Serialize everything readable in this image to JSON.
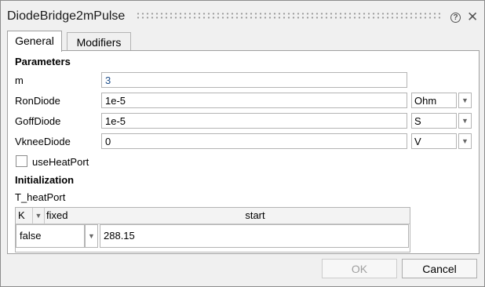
{
  "dialog": {
    "title": "DiodeBridge2mPulse"
  },
  "tabs": [
    {
      "label": "General"
    },
    {
      "label": "Modifiers"
    }
  ],
  "parameters": {
    "heading": "Parameters",
    "rows": [
      {
        "name": "m",
        "value": "3",
        "unit": ""
      },
      {
        "name": "RonDiode",
        "value": "1e-5",
        "unit": "Ohm"
      },
      {
        "name": "GoffDiode",
        "value": "1e-5",
        "unit": "S"
      },
      {
        "name": "VkneeDiode",
        "value": "0",
        "unit": "V"
      }
    ],
    "checkbox_label": "useHeatPort"
  },
  "initialization": {
    "heading": "Initialization",
    "variable": "T_heatPort",
    "unit": "K",
    "col_fixed": "fixed",
    "col_start": "start",
    "fixed_value": "false",
    "start_value": "288.15"
  },
  "buttons": {
    "ok": "OK",
    "cancel": "Cancel"
  }
}
